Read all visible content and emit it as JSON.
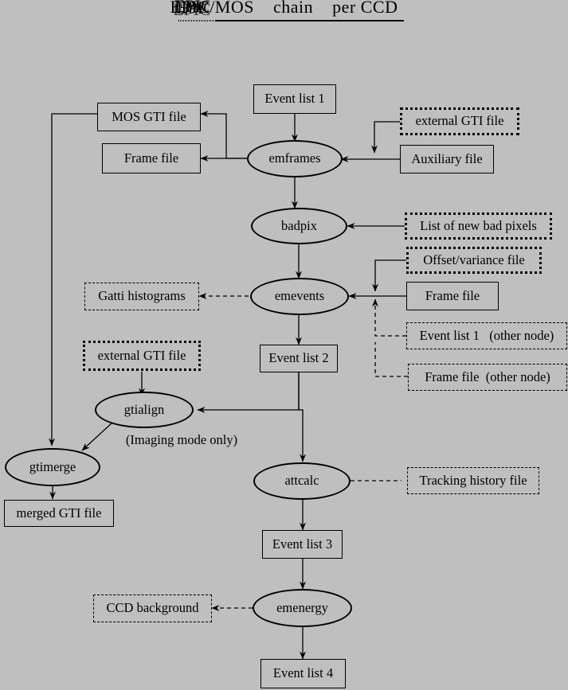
{
  "diagram": {
    "title": "EPIC/MOS    chain    per CCD",
    "title_prefix_glitch": "EPIC",
    "title_suffix": "/MOS    chain    per CCD",
    "background_color": "#bfbfbf",
    "line_color": "#000000",
    "annotation": "(Imaging mode only)"
  },
  "nodes": {
    "event_list_1": {
      "label": "Event list 1",
      "shape": "box",
      "style": "solid"
    },
    "mos_gti_file": {
      "label": "MOS GTI file",
      "shape": "box",
      "style": "solid"
    },
    "frame_file_top": {
      "label": "Frame file",
      "shape": "box",
      "style": "solid"
    },
    "emframes": {
      "label": "emframes",
      "shape": "ellipse",
      "style": "solid"
    },
    "external_gti_file_top": {
      "label": "external GTI file",
      "shape": "box",
      "style": "dotted"
    },
    "auxiliary_file": {
      "label": "Auxiliary file",
      "shape": "box",
      "style": "solid"
    },
    "badpix": {
      "label": "badpix",
      "shape": "ellipse",
      "style": "solid"
    },
    "list_of_new_bad_pixels": {
      "label": "List of new bad pixels",
      "shape": "box",
      "style": "dotted"
    },
    "offset_variance_file": {
      "label": "Offset/variance file",
      "shape": "box",
      "style": "dotted"
    },
    "gatti_histograms": {
      "label": "Gatti histograms",
      "shape": "box",
      "style": "dashed"
    },
    "emevents": {
      "label": "emevents",
      "shape": "ellipse",
      "style": "solid"
    },
    "frame_file_mid": {
      "label": "Frame file",
      "shape": "box",
      "style": "solid"
    },
    "event_list_1_other_node": {
      "label": "Event list 1   (other node)",
      "shape": "box",
      "style": "dashed"
    },
    "frame_file_other_node": {
      "label": "Frame file  (other node)",
      "shape": "box",
      "style": "dashed"
    },
    "external_gti_file_left": {
      "label": "external GTI file",
      "shape": "box",
      "style": "dotted"
    },
    "event_list_2": {
      "label": "Event list 2",
      "shape": "box",
      "style": "solid"
    },
    "gtialign": {
      "label": "gtialign",
      "shape": "ellipse",
      "style": "solid"
    },
    "imaging_mode_note": {
      "label": "(Imaging mode only)",
      "shape": "text",
      "style": "none"
    },
    "gtimerge": {
      "label": "gtimerge",
      "shape": "ellipse",
      "style": "solid"
    },
    "merged_gti_file": {
      "label": "merged GTI file",
      "shape": "box",
      "style": "solid"
    },
    "attcalc": {
      "label": "attcalc",
      "shape": "ellipse",
      "style": "solid"
    },
    "tracking_history_file": {
      "label": "Tracking history file",
      "shape": "box",
      "style": "dashed"
    },
    "event_list_3": {
      "label": "Event list 3",
      "shape": "box",
      "style": "solid"
    },
    "ccd_background": {
      "label": "CCD background",
      "shape": "box",
      "style": "dashed"
    },
    "emenergy": {
      "label": "emenergy",
      "shape": "ellipse",
      "style": "solid"
    },
    "event_list_4": {
      "label": "Event list 4",
      "shape": "box",
      "style": "solid"
    }
  },
  "edges": [
    {
      "from": "event_list_1",
      "to": "emframes",
      "style": "solid"
    },
    {
      "from": "emframes",
      "to": "mos_gti_file",
      "style": "solid"
    },
    {
      "from": "emframes",
      "to": "frame_file_top",
      "style": "solid"
    },
    {
      "from": "external_gti_file_top",
      "to": "emframes",
      "style": "solid"
    },
    {
      "from": "auxiliary_file",
      "to": "emframes",
      "style": "solid"
    },
    {
      "from": "emframes",
      "to": "badpix",
      "style": "solid"
    },
    {
      "from": "list_of_new_bad_pixels",
      "to": "badpix",
      "style": "solid"
    },
    {
      "from": "badpix",
      "to": "emevents",
      "style": "solid"
    },
    {
      "from": "offset_variance_file",
      "to": "emevents",
      "style": "solid"
    },
    {
      "from": "frame_file_mid",
      "to": "emevents",
      "style": "solid"
    },
    {
      "from": "event_list_1_other_node",
      "to": "emevents",
      "style": "dashed"
    },
    {
      "from": "frame_file_other_node",
      "to": "emevents",
      "style": "dashed"
    },
    {
      "from": "emevents",
      "to": "gatti_histograms",
      "style": "dashed"
    },
    {
      "from": "emevents",
      "to": "event_list_2",
      "style": "solid"
    },
    {
      "from": "external_gti_file_left",
      "to": "gtialign",
      "style": "solid"
    },
    {
      "from": "event_list_2",
      "to": "gtialign",
      "style": "solid"
    },
    {
      "from": "gtialign",
      "to": "gtimerge",
      "style": "solid"
    },
    {
      "from": "mos_gti_file",
      "to": "gtimerge",
      "style": "solid"
    },
    {
      "from": "gtimerge",
      "to": "merged_gti_file",
      "style": "solid"
    },
    {
      "from": "event_list_2",
      "to": "attcalc",
      "style": "solid"
    },
    {
      "from": "attcalc",
      "to": "tracking_history_file",
      "style": "dashed"
    },
    {
      "from": "attcalc",
      "to": "event_list_3",
      "style": "solid"
    },
    {
      "from": "event_list_3",
      "to": "emenergy",
      "style": "solid"
    },
    {
      "from": "emenergy",
      "to": "ccd_background",
      "style": "dashed"
    },
    {
      "from": "emenergy",
      "to": "event_list_4",
      "style": "solid"
    }
  ]
}
